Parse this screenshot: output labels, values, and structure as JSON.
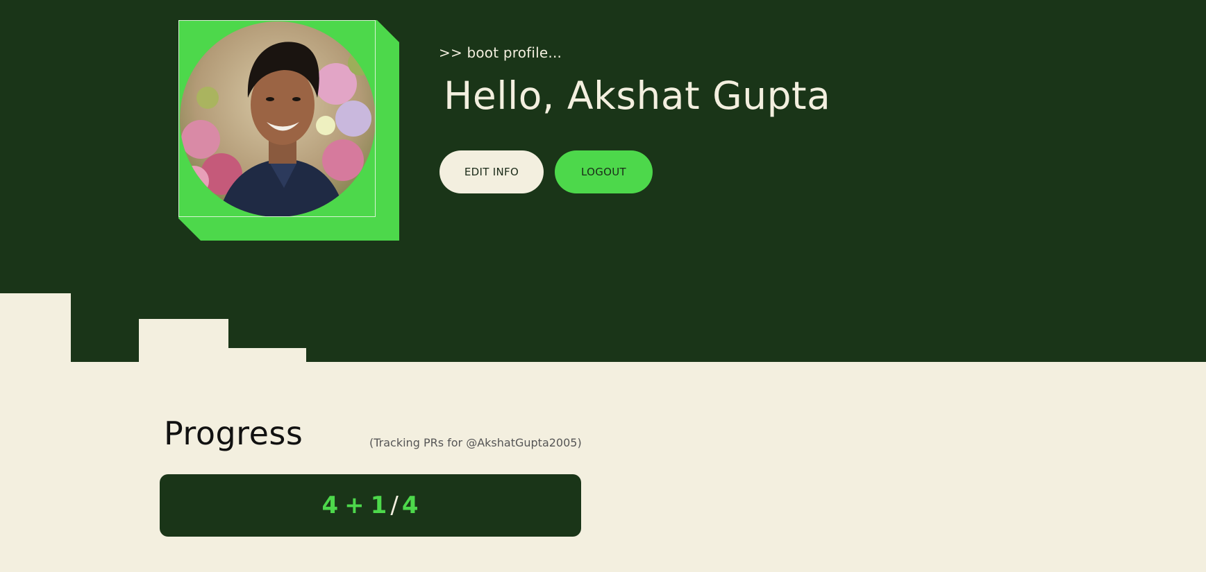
{
  "profile": {
    "boot_text": ">> boot profile...",
    "greeting": "Hello, Akshat Gupta",
    "edit_label": "EDIT INFO",
    "logout_label": "LOGOUT",
    "avatar_icon": "profile-photo"
  },
  "progress": {
    "title": "Progress",
    "tracking": "(Tracking PRs for @AkshatGupta2005)",
    "score": {
      "merged": "4",
      "plus": "+",
      "extra": "1",
      "slash": "/",
      "target": "4"
    }
  },
  "colors": {
    "dark_green": "#1a3518",
    "accent_green": "#4dd84b",
    "cream": "#f3efdf"
  }
}
